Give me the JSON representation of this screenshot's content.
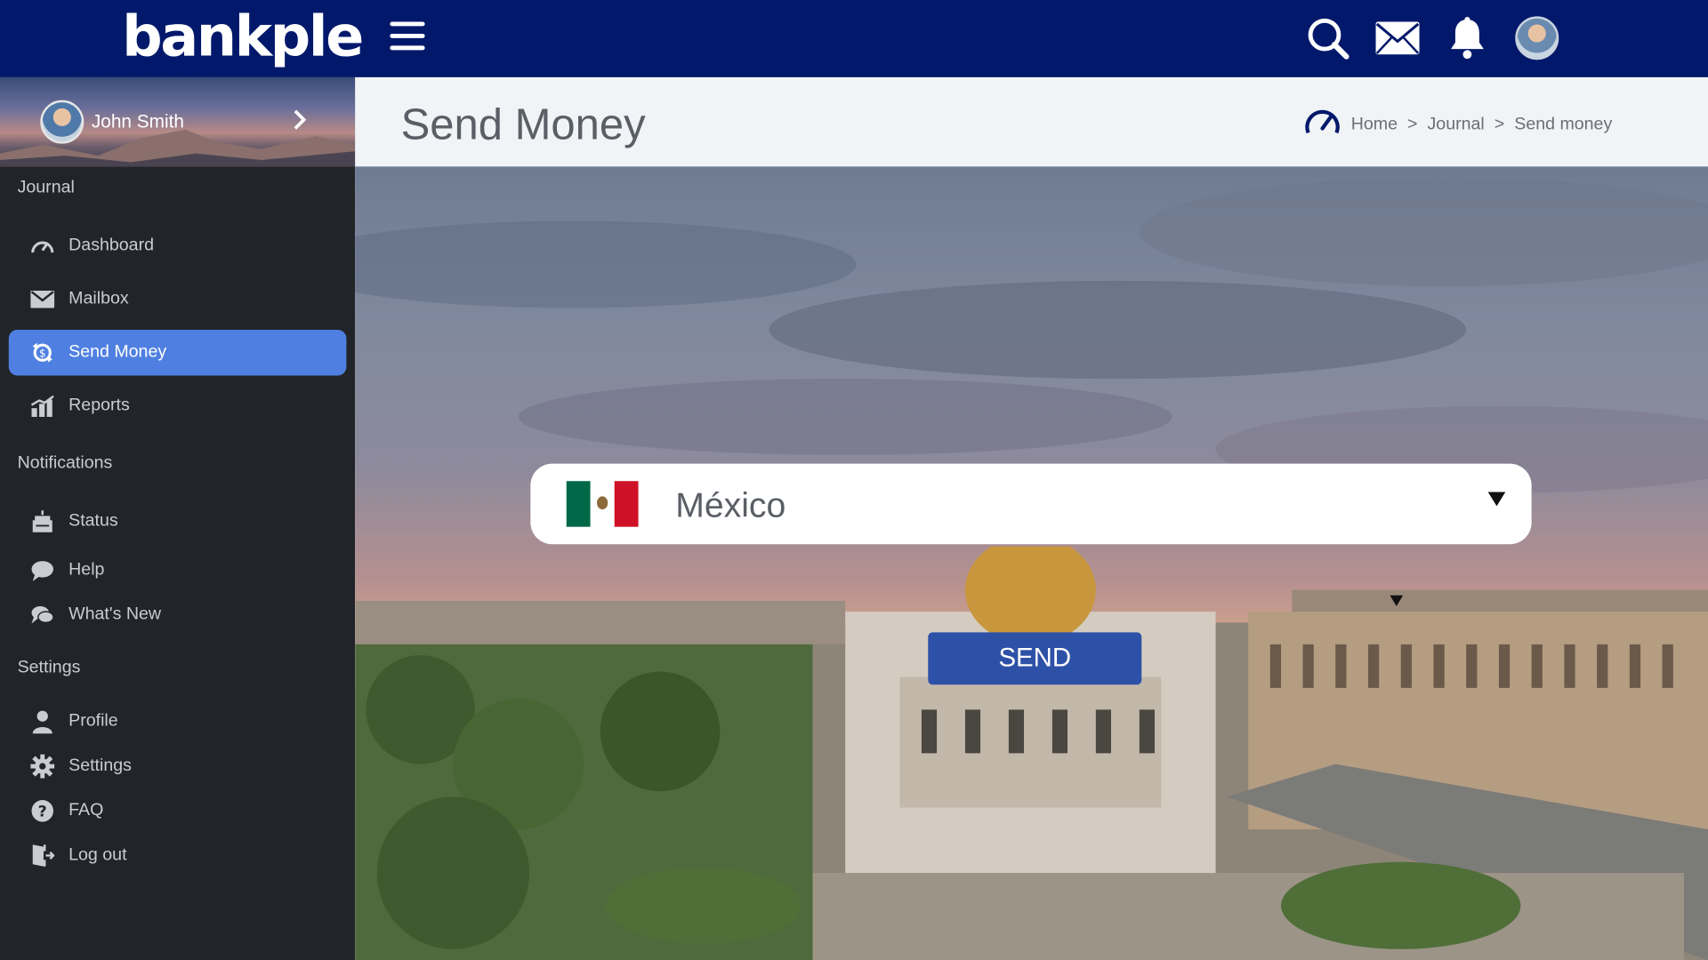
{
  "brand": {
    "logo_text": "bankple",
    "topbar_color": "#02196b"
  },
  "topbar": {
    "icons": [
      "menu-icon",
      "search-icon",
      "mail-icon",
      "bell-icon",
      "user-avatar"
    ]
  },
  "user": {
    "name": "John Smith"
  },
  "sidebar": {
    "sections": [
      {
        "title": "Journal",
        "items": [
          {
            "label": "Dashboard",
            "icon": "gauge-icon",
            "active": false
          },
          {
            "label": "Mailbox",
            "icon": "mail-icon",
            "active": false
          },
          {
            "label": "Send Money",
            "icon": "money-transfer-icon",
            "active": true
          },
          {
            "label": "Reports",
            "icon": "bar-chart-icon",
            "active": false
          }
        ]
      },
      {
        "title": "Notifications",
        "items": [
          {
            "label": "Status",
            "icon": "cake-icon",
            "active": false
          },
          {
            "label": "Help",
            "icon": "chat-bubble-icon",
            "active": false
          },
          {
            "label": "What's New",
            "icon": "chat-bubbles-icon",
            "active": false
          }
        ]
      },
      {
        "title": "Settings",
        "items": [
          {
            "label": "Profile",
            "icon": "person-icon",
            "active": false
          },
          {
            "label": "Settings",
            "icon": "gear-icon",
            "active": false
          },
          {
            "label": "FAQ",
            "icon": "question-circle-icon",
            "active": false
          },
          {
            "label": "Log out",
            "icon": "door-exit-icon",
            "active": false
          }
        ]
      }
    ],
    "active_color": "#4f80e1"
  },
  "page": {
    "title": "Send Money",
    "breadcrumb": [
      "Home",
      "Journal",
      "Send money"
    ],
    "breadcrumb_separator": ">"
  },
  "transfer": {
    "country": "México",
    "flag_colors": [
      "#006847",
      "#ffffff",
      "#ce1126"
    ],
    "send_label": "SEND",
    "send_color": "#2e51a8"
  }
}
